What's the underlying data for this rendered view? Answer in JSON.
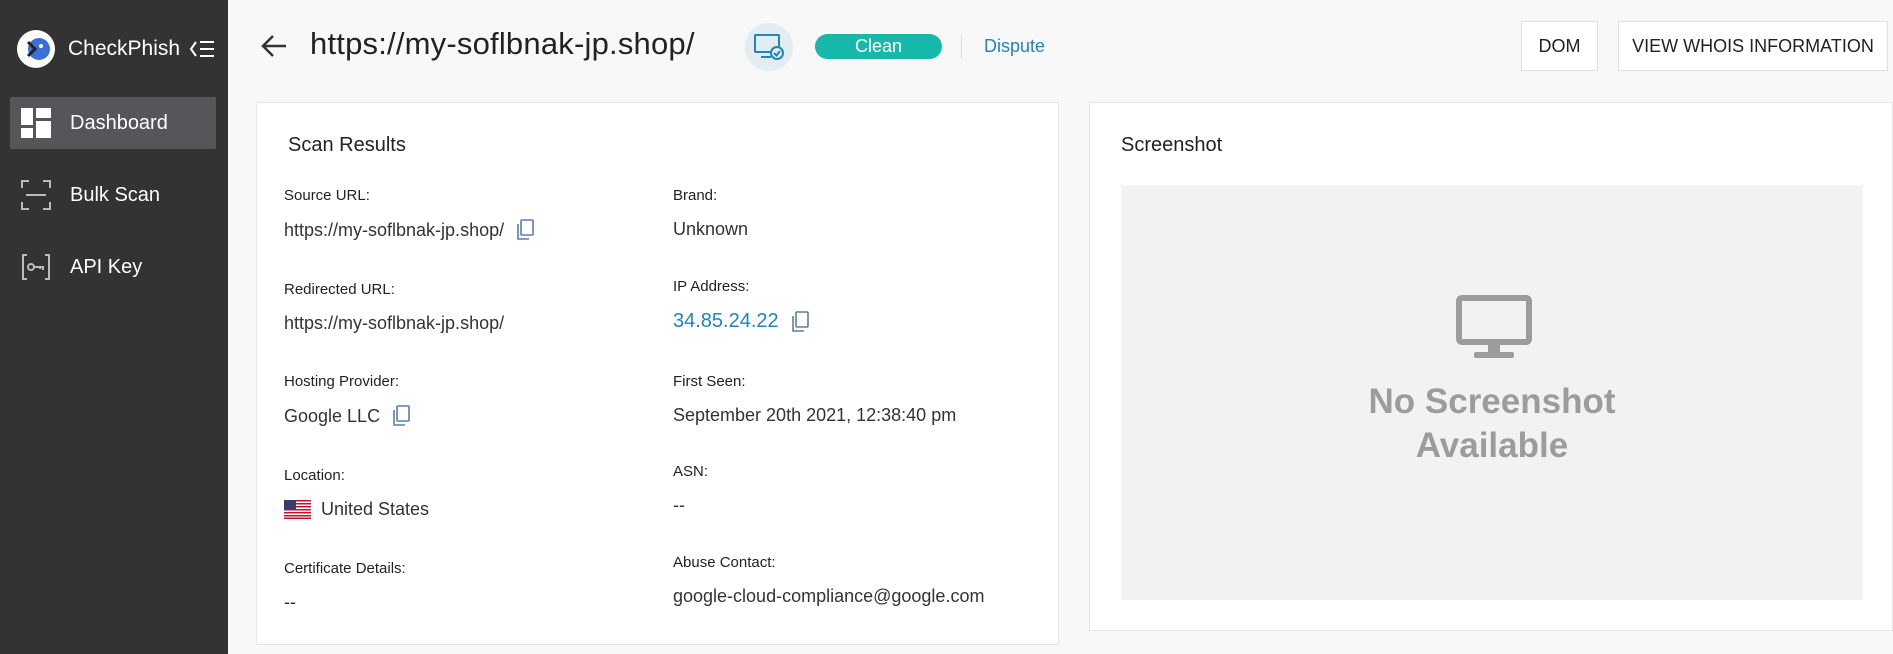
{
  "sidebar": {
    "brand_name": "CheckPhish",
    "items": [
      {
        "label": "Dashboard",
        "icon": "dashboard-icon",
        "active": true
      },
      {
        "label": "Bulk Scan",
        "icon": "scan-frame-icon",
        "active": false
      },
      {
        "label": "API Key",
        "icon": "key-icon",
        "active": false
      }
    ]
  },
  "header": {
    "url": "https://my-soflbnak-jp.shop/",
    "status": "Clean",
    "dispute_label": "Dispute",
    "dom_button": "DOM",
    "whois_button": "VIEW WHOIS INFORMATION"
  },
  "scan_results": {
    "title": "Scan Results",
    "source_url": {
      "label": "Source URL:",
      "value": "https://my-soflbnak-jp.shop/"
    },
    "redirected_url": {
      "label": "Redirected URL:",
      "value": "https://my-soflbnak-jp.shop/"
    },
    "hosting_provider": {
      "label": "Hosting Provider:",
      "value": "Google LLC"
    },
    "location": {
      "label": "Location:",
      "value": "United States"
    },
    "certificate": {
      "label": "Certificate Details:",
      "value": "--"
    },
    "brand": {
      "label": "Brand:",
      "value": "Unknown"
    },
    "ip_address": {
      "label": "IP Address:",
      "value": "34.85.24.22"
    },
    "first_seen": {
      "label": "First Seen:",
      "value": "September 20th 2021, 12:38:40 pm"
    },
    "asn": {
      "label": "ASN:",
      "value": "--"
    },
    "abuse_contact": {
      "label": "Abuse Contact:",
      "value": "google-cloud-compliance@google.com"
    }
  },
  "screenshot": {
    "title": "Screenshot",
    "placeholder_line1": "No Screenshot",
    "placeholder_line2": "Available"
  },
  "colors": {
    "sidebar_bg": "#333333",
    "accent": "#16b8aa",
    "link": "#1e86b8"
  }
}
